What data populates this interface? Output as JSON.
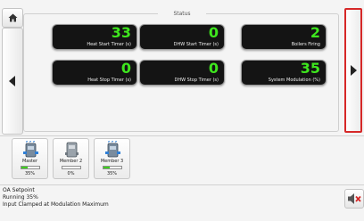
{
  "status": {
    "title": "Status",
    "tiles": [
      {
        "value": "33",
        "label": "Heat Start Timer (s)"
      },
      {
        "value": "0",
        "label": "DHW Start Timer (s)"
      },
      {
        "value": "2",
        "label": "Boilers Firing"
      },
      {
        "value": "0",
        "label": "Heat Stop Timer (s)"
      },
      {
        "value": "0",
        "label": "DHW Stop Timer (s)"
      },
      {
        "value": "35",
        "label": "System Modulation (%)"
      }
    ],
    "value_color": "#3ee61e"
  },
  "members": [
    {
      "name": "Master",
      "percent": "35%",
      "level": 0.35,
      "icon": "boiler-icon"
    },
    {
      "name": "Member 2",
      "percent": "0%",
      "level": 0,
      "icon": "boiler-off-icon"
    },
    {
      "name": "Member 3",
      "percent": "35%",
      "level": 0.35,
      "icon": "boiler-icon"
    }
  ],
  "info": {
    "line1": "OA Setpoint",
    "line2": "Running 35%",
    "line3": "Input Clamped at Modulation Maximum"
  },
  "icons": {
    "home": "home-icon",
    "prev": "arrow-left-icon",
    "next": "arrow-right-icon",
    "mute": "speaker-muted-icon"
  },
  "colors": {
    "highlight": "#d62828",
    "tile_bg": "#141414",
    "bar_fill": "#3fcf1e"
  }
}
